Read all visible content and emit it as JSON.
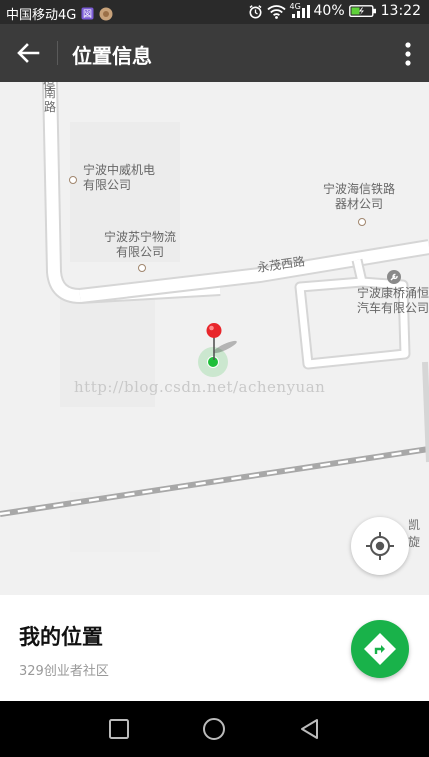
{
  "status_bar": {
    "carrier": "中国移动4G",
    "network_small": "4G",
    "battery": "40%",
    "time": "13:22"
  },
  "appbar": {
    "title": "位置信息"
  },
  "map": {
    "pois": [
      {
        "line1": "宁波中威机电",
        "line2": "有限公司"
      },
      {
        "line1": "宁波苏宁物流",
        "line2": "有限公司"
      },
      {
        "line1": "宁波海信铁路",
        "line2": "器材公司"
      },
      {
        "line1": "宁波康桥涌恒",
        "line2": "汽车有限公司"
      }
    ],
    "roads": {
      "nanlu": "南路",
      "north_cut": "停",
      "yongmao": "永茂西路",
      "kaixuan": "凯旋"
    },
    "watermark": "http://blog.csdn.net/achenyuan",
    "colors": {
      "pin": "#e8262b",
      "dot": "#1fbf3a",
      "road_edge": "#d6d6d6",
      "rail": "#9e9e9e"
    }
  },
  "location": {
    "title": "我的位置",
    "address": "329创业者社区"
  },
  "colors": {
    "appbar": "#3b3b3b",
    "accent": "#19b24a"
  }
}
